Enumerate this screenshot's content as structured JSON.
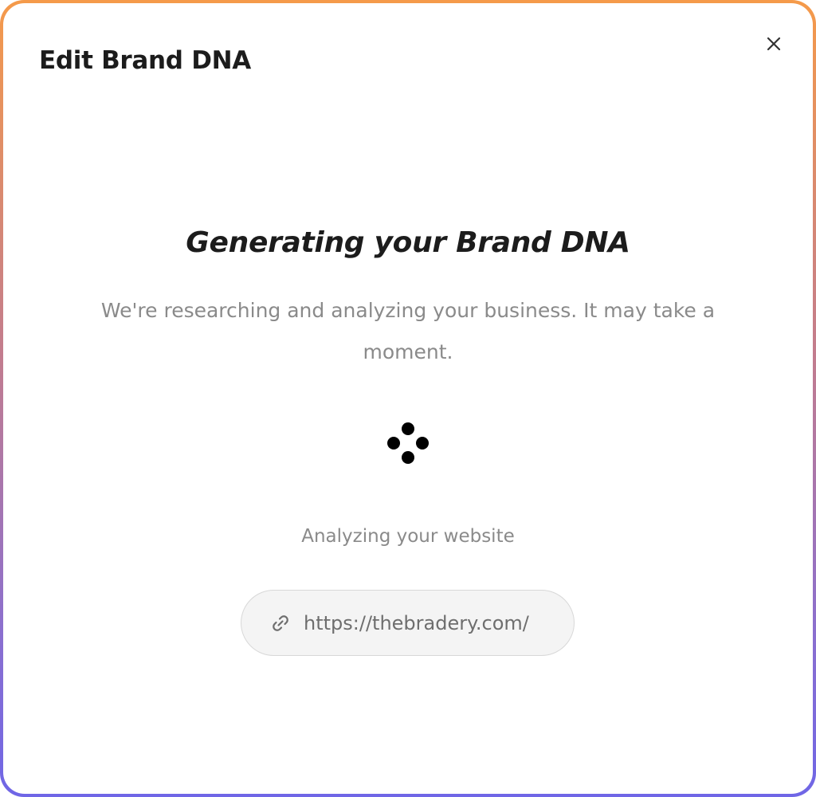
{
  "modal": {
    "title": "Edit Brand DNA",
    "close_icon": "close-icon"
  },
  "content": {
    "heading": "Generating your Brand DNA",
    "subtext": "We're researching and analyzing your business. It may take a moment.",
    "spinner_icon": "loading-dots-icon",
    "status": "Analyzing your website",
    "url": {
      "icon": "link-icon",
      "value": "https://thebradery.com/"
    }
  },
  "colors": {
    "border_gradient_top": "#f59a4a",
    "border_gradient_bottom": "#6f66e6",
    "text_dark": "#1c1c1c",
    "text_muted": "#8a8a8a"
  }
}
